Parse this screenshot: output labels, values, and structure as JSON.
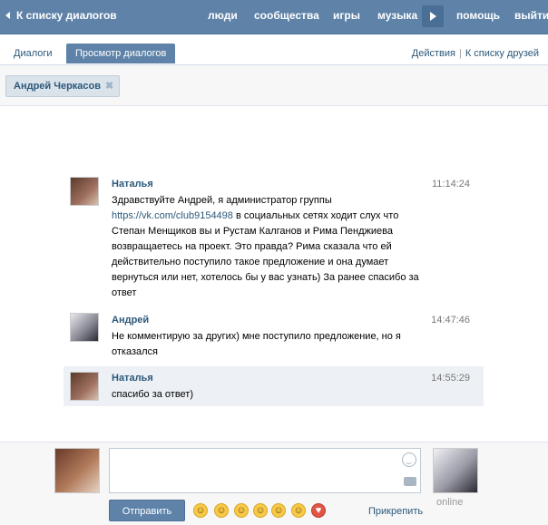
{
  "topbar": {
    "back_label": "К списку диалогов",
    "nav": [
      "люди",
      "сообщества",
      "игры",
      "музыка",
      "помощь",
      "выйти"
    ]
  },
  "tabs": {
    "dialogs": "Диалоги",
    "view_dialogs": "Просмотр диалогов",
    "actions": "Действия",
    "separator": "|",
    "friends_list": "К списку друзей"
  },
  "filter": {
    "chip_label": "Андрей Черкасов",
    "chip_close": "✖"
  },
  "messages": [
    {
      "author": "Наталья",
      "time": "11:14:24",
      "text_before": "Здравствуйте Андрей, я администратор группы ",
      "link": "https://vk.com/club9154498",
      "text_after": " в социальных сетях ходит слух что Степан Менщиков вы и Рустам Калганов и Рима Пенджиева возвращаетесь на проект. Это правда? Рима сказала что ей действительно поступило такое предложение и она думает вернуться или нет, хотелось бы у вас узнать) За ранее спасибо за ответ"
    },
    {
      "author": "Андрей",
      "time": "14:47:46",
      "text": "Не комментирую за других) мне поступило предложение, но я отказался"
    },
    {
      "author": "Наталья",
      "time": "14:55:29",
      "text": "спасибо за ответ)"
    }
  ],
  "composer": {
    "send_label": "Отправить",
    "attach_label": "Прикрепить",
    "online_label": "online"
  },
  "colors": {
    "header_blue": "#5e82a8",
    "link_blue": "#2b587a",
    "highlight": "#edf1f5"
  }
}
